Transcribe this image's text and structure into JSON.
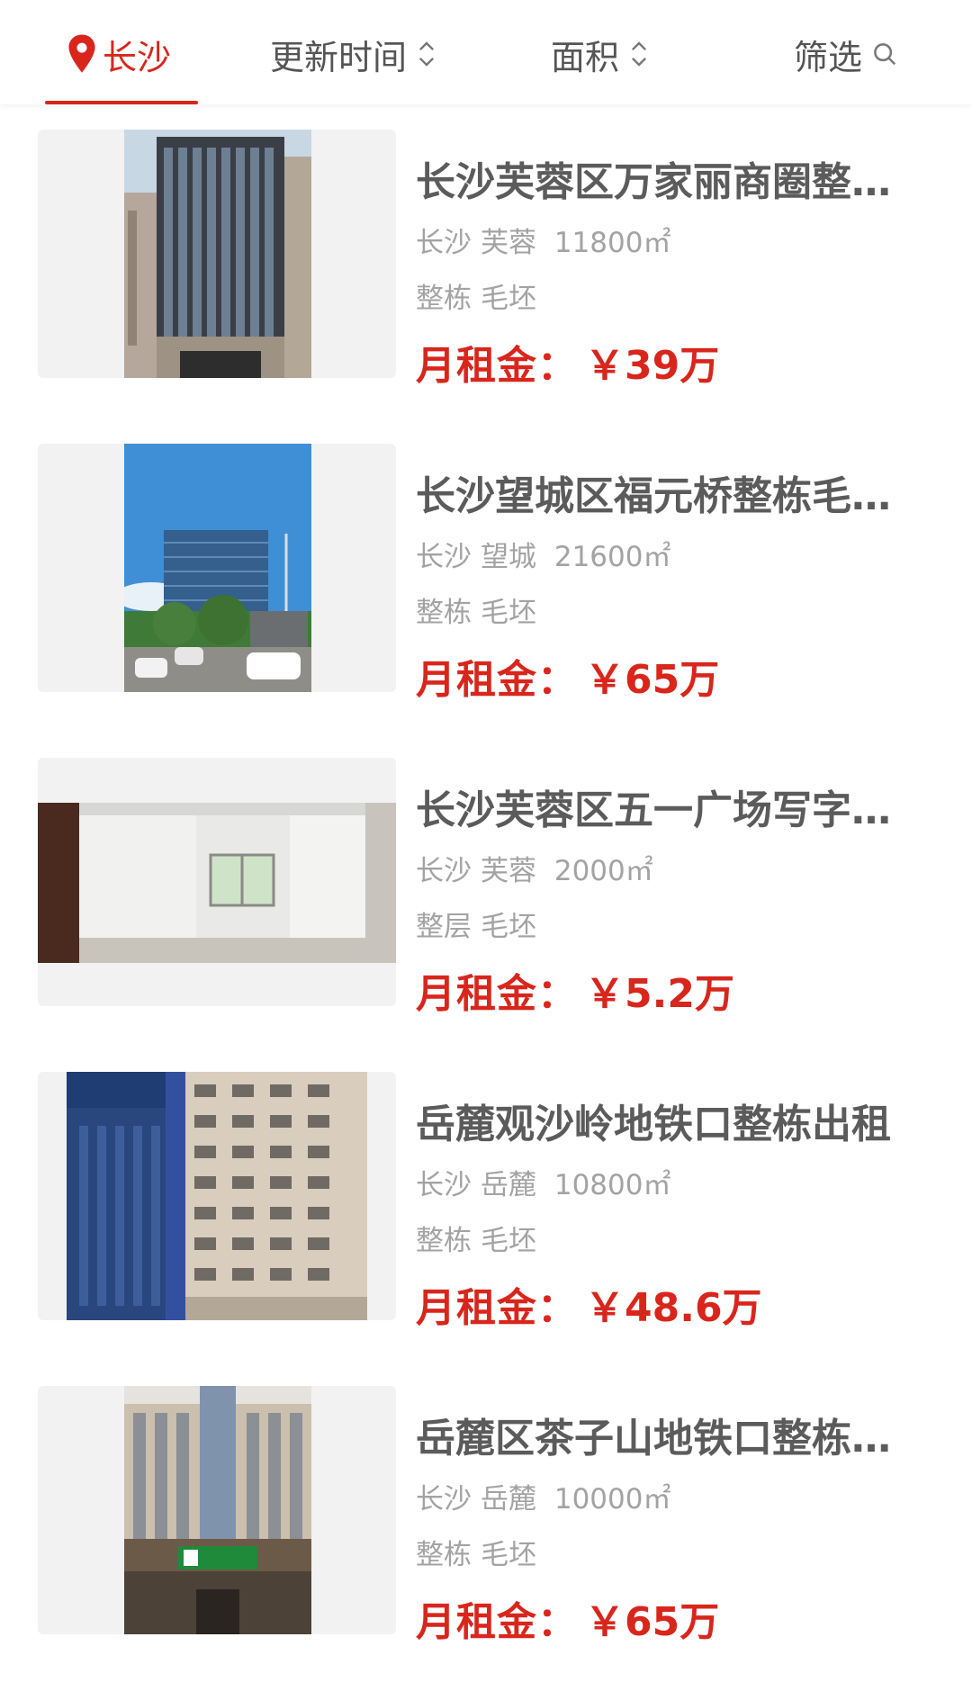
{
  "filter_bar": {
    "city": "长沙",
    "sort_time": "更新时间",
    "sort_area": "面积",
    "filter": "筛选",
    "colors": {
      "accent": "#d8261c",
      "text": "#555555"
    }
  },
  "listings": [
    {
      "title": "长沙芙蓉区万家丽商圈整栋出租",
      "city": "长沙",
      "district": "芙蓉",
      "area": "11800㎡",
      "tag1": "整栋",
      "tag2": "毛坯",
      "price_label": "月租金：",
      "price": "￥39万"
    },
    {
      "title": "长沙望城区福元桥整栋毛坯出租",
      "city": "长沙",
      "district": "望城",
      "area": "21600㎡",
      "tag1": "整栋",
      "tag2": "毛坯",
      "price_label": "月租金：",
      "price": "￥65万"
    },
    {
      "title": "长沙芙蓉区五一广场写字楼出租",
      "city": "长沙",
      "district": "芙蓉",
      "area": "2000㎡",
      "tag1": "整层",
      "tag2": "毛坯",
      "price_label": "月租金：",
      "price": "￥5.2万"
    },
    {
      "title": "岳麓观沙岭地铁口整栋出租",
      "city": "长沙",
      "district": "岳麓",
      "area": "10800㎡",
      "tag1": "整栋",
      "tag2": "毛坯",
      "price_label": "月租金：",
      "price": "￥48.6万"
    },
    {
      "title": "岳麓区茶子山地铁口整栋出租",
      "city": "长沙",
      "district": "岳麓",
      "area": "10000㎡",
      "tag1": "整栋",
      "tag2": "毛坯",
      "price_label": "月租金：",
      "price": "￥65万"
    }
  ]
}
